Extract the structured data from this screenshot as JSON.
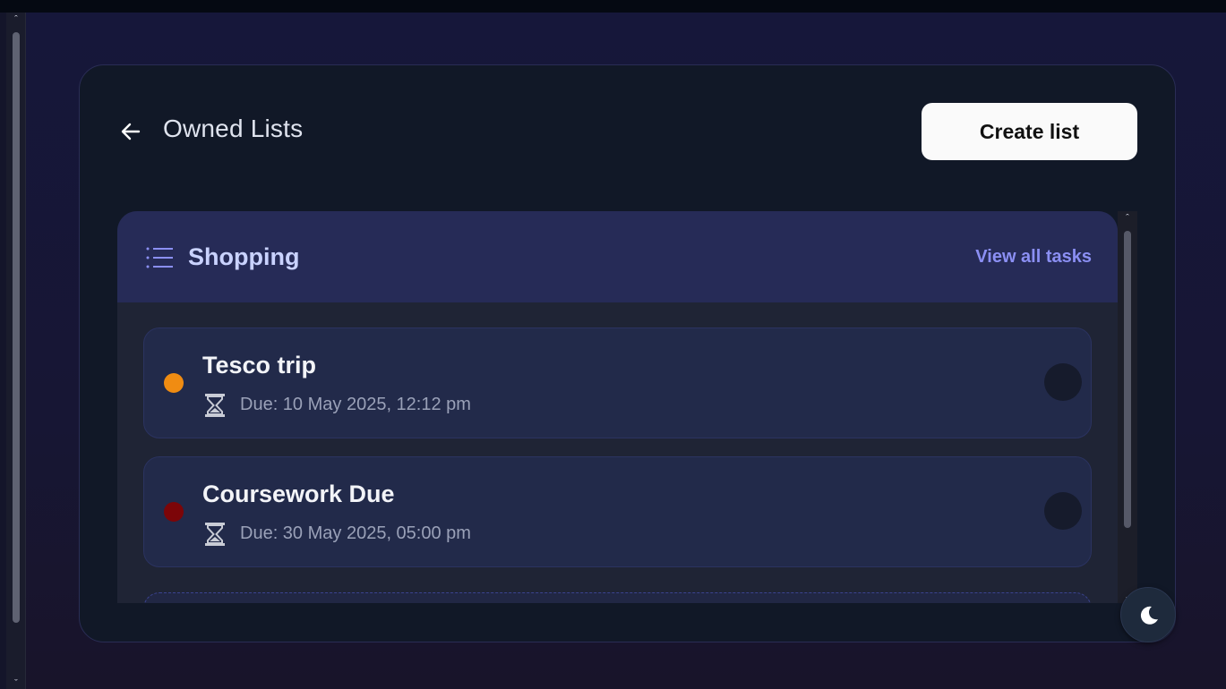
{
  "header": {
    "title": "Owned Lists",
    "create_label": "Create list"
  },
  "list": {
    "name": "Shopping",
    "view_all_label": "View all tasks"
  },
  "tasks": [
    {
      "title": "Tesco trip",
      "due": "Due: 10 May 2025, 12:12 pm",
      "priority_color": "#f08c12"
    },
    {
      "title": "Coursework Due",
      "due": "Due: 30 May 2025, 05:00 pm",
      "priority_color": "#7c0508"
    }
  ],
  "colors": {
    "accent": "#8b8ff3",
    "card_bg": "#111827",
    "list_header_bg": "#262b57"
  },
  "icons": {
    "back": "arrow-left-icon",
    "list": "list-icon",
    "due": "hourglass-icon",
    "theme": "moon-icon"
  }
}
